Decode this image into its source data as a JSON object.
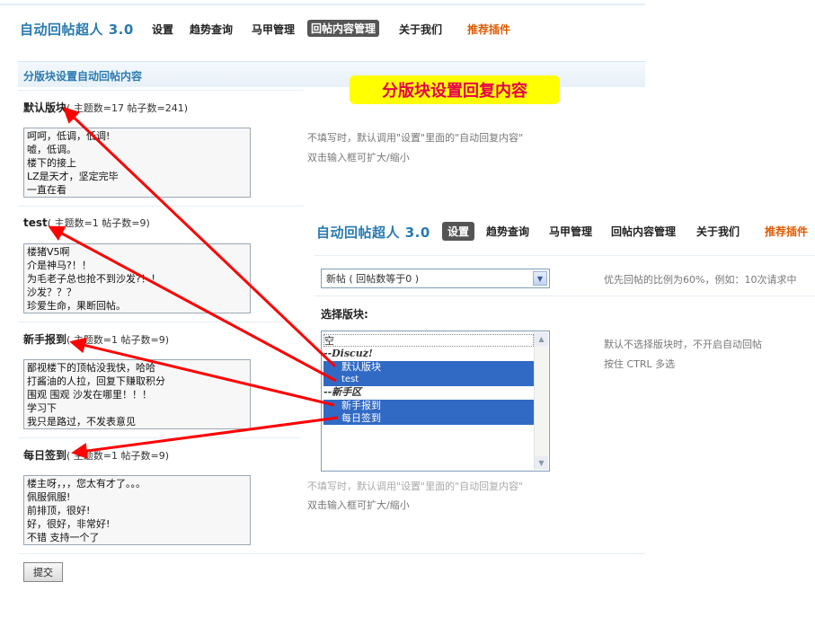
{
  "top_nav": {
    "brand": "自动回帖超人 3.0",
    "items": [
      "设置",
      "趋势查询",
      "马甲管理",
      "回帖内容管理",
      "关于我们"
    ],
    "active_index": 3,
    "hot": "推荐插件"
  },
  "section": {
    "title": "分版块设置自动回帖内容"
  },
  "banner": "分版块设置回复内容",
  "boards": [
    {
      "name": "默认版块",
      "meta": "( 主题数=17  帖子数=241)",
      "content": [
        "呵呵，低调，低调!",
        "嘘，低调。",
        "楼下的接上",
        "LZ是天才，坚定完毕",
        "一直在看"
      ]
    },
    {
      "name": "test",
      "meta": "( 主题数=1  帖子数=9)",
      "content": [
        "楼猪V5啊",
        "介是神马?！！",
        "为毛老子总也抢不到沙发?！！",
        "沙发？？？",
        "珍爱生命，果断回帖。"
      ]
    },
    {
      "name": "新手报到",
      "meta": "( 主题数=1  帖子数=9)",
      "content": [
        "鄙视楼下的顶帖没我快，哈哈",
        "打酱油的人拉，回复下赚取积分",
        "围观 围观 沙发在哪里！！！",
        "学习下",
        "我只是路过，不发表意见"
      ]
    },
    {
      "name": "每日签到",
      "meta": "( 主题数=1  帖子数=9)",
      "content": [
        "楼主呀，，，您太有才了。。。",
        "佩服佩服!",
        "前排顶，很好!",
        "好，很好，非常好!",
        "不错 支持一个了"
      ]
    }
  ],
  "hints": {
    "default_reply": "不填写时，默认调用\"设置\"里面的\"自动回复内容\"",
    "dblclick": "双击输入框可扩大/缩小",
    "default_reply_partial": "不填写时，默认调用\"设置\"里面的\"自动回复内容\""
  },
  "submit_label": "提交",
  "overlay": {
    "brand": "自动回帖超人 3.0",
    "nav": [
      "设置",
      "趋势查询",
      "马甲管理",
      "回帖内容管理",
      "关于我们"
    ],
    "active_index": 0,
    "hot": "推荐插件",
    "dropdown_value": "新帖 ( 回帖数等于0 )",
    "priority_hint": "优先回帖的比例为60%，例如：10次请求中",
    "select_board_label": "选择版块:",
    "list_items": [
      {
        "text": "空",
        "type": "option",
        "selected": false
      },
      {
        "text": "--Discuz!",
        "type": "group",
        "selected": false
      },
      {
        "text": "默认版块",
        "type": "option",
        "selected": true
      },
      {
        "text": "test",
        "type": "option",
        "selected": true
      },
      {
        "text": "--新手区",
        "type": "group",
        "selected": false
      },
      {
        "text": "新手报到",
        "type": "option",
        "selected": true
      },
      {
        "text": "每日签到",
        "type": "option",
        "selected": true
      }
    ],
    "board_hint1": "默认不选择版块时，不开启自动回帖",
    "board_hint2": "按住 CTRL 多选"
  },
  "colors": {
    "brand": "#2a7ab0",
    "hot": "#e05a00",
    "banner_bg": "#ffff00",
    "banner_text": "#e5004f",
    "arrow": "#ff0000",
    "selection": "#316ac5"
  }
}
